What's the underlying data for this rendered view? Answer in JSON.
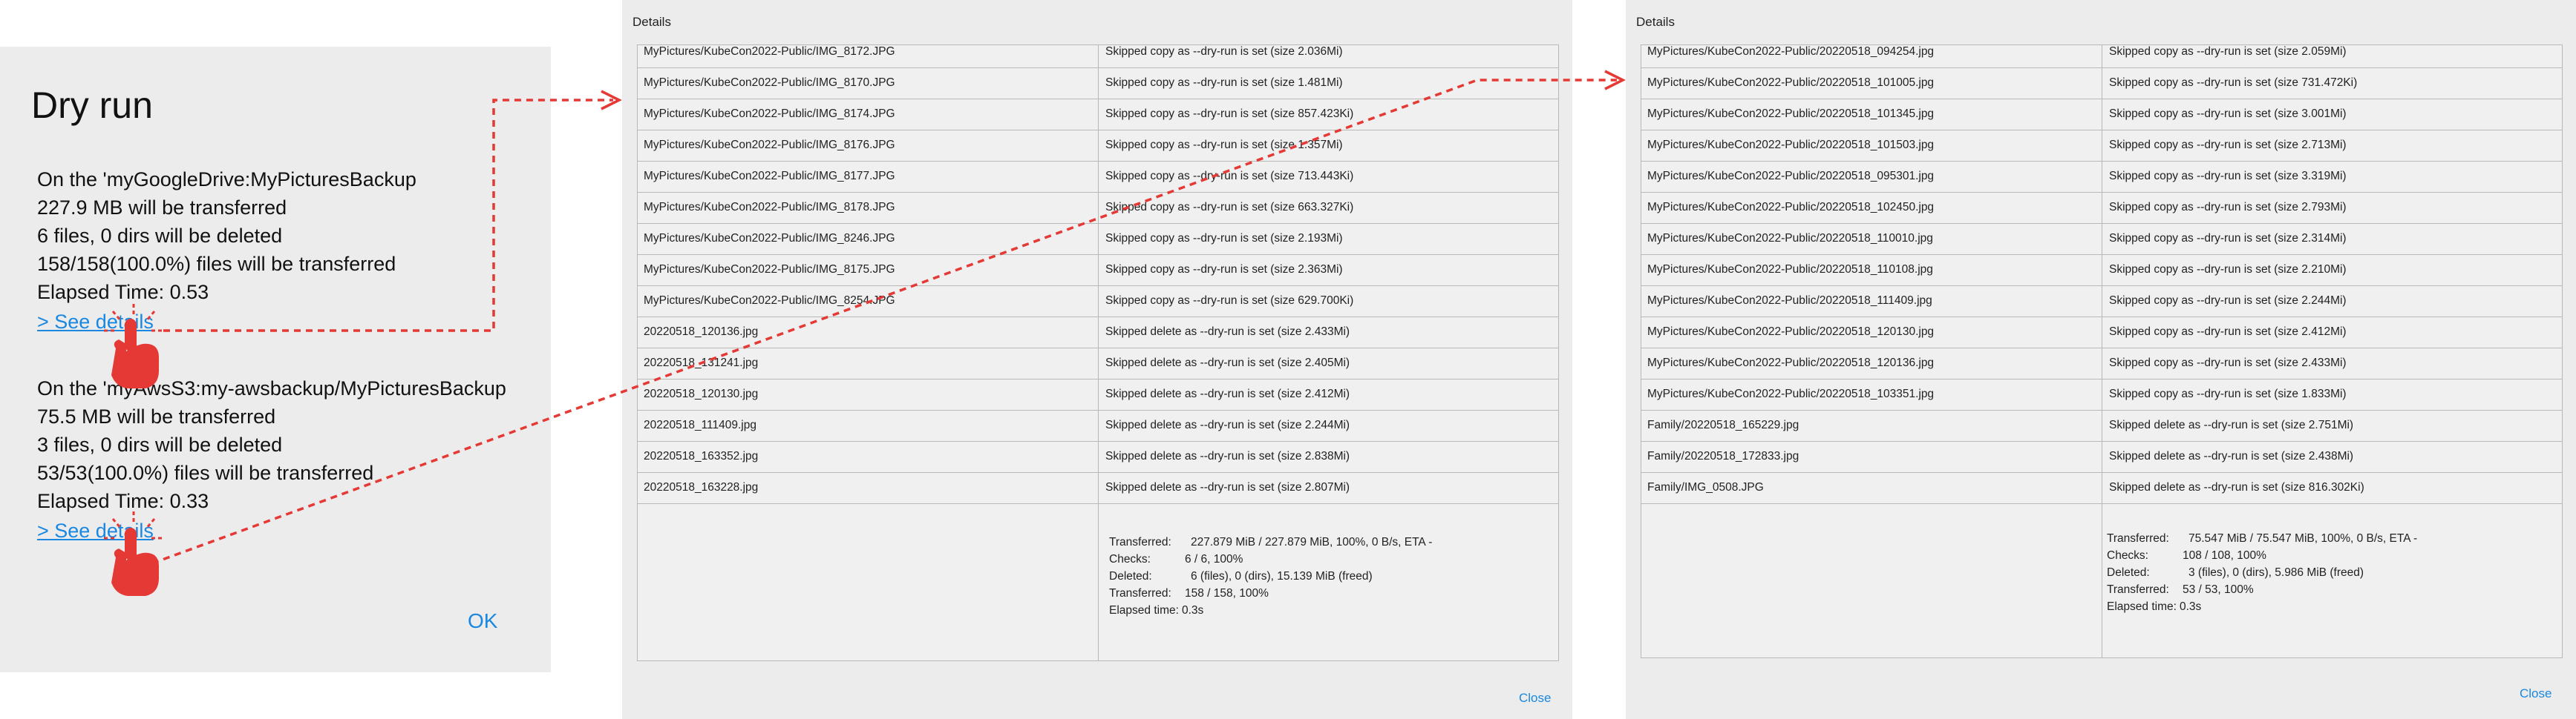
{
  "dry_run": {
    "title": "Dry run",
    "summaries": [
      {
        "remote_line": "On the 'myGoogleDrive:MyPicturesBackup",
        "size_line": "227.9 MB will be transferred",
        "files_line": "6 files, 0 dirs will be deleted",
        "count_line": "158/158(100.0%) files will be transferred",
        "elapsed_line": "Elapsed Time: 0.53",
        "link": "> See details"
      },
      {
        "remote_line": "On the 'myAwsS3:my-awsbackup/MyPicturesBackup",
        "size_line": "75.5 MB will be transferred",
        "files_line": "3 files, 0 dirs will be deleted",
        "count_line": "53/53(100.0%) files will be transferred",
        "elapsed_line": "Elapsed Time: 0.33",
        "link": "> See details"
      }
    ],
    "ok_label": "OK"
  },
  "details_windows": [
    {
      "title": "Details",
      "rows": [
        {
          "file": "MyPictures/KubeCon2022-Public/IMG_8172.JPG",
          "status": "Skipped copy as --dry-run is set (size 2.036Mi)"
        },
        {
          "file": "MyPictures/KubeCon2022-Public/IMG_8170.JPG",
          "status": "Skipped copy as --dry-run is set (size 1.481Mi)"
        },
        {
          "file": "MyPictures/KubeCon2022-Public/IMG_8174.JPG",
          "status": "Skipped copy as --dry-run is set (size 857.423Ki)"
        },
        {
          "file": "MyPictures/KubeCon2022-Public/IMG_8176.JPG",
          "status": "Skipped copy as --dry-run is set (size 1.357Mi)"
        },
        {
          "file": "MyPictures/KubeCon2022-Public/IMG_8177.JPG",
          "status": "Skipped copy as --dry-run is set (size 713.443Ki)"
        },
        {
          "file": "MyPictures/KubeCon2022-Public/IMG_8178.JPG",
          "status": "Skipped copy as --dry-run is set (size 663.327Ki)"
        },
        {
          "file": "MyPictures/KubeCon2022-Public/IMG_8246.JPG",
          "status": "Skipped copy as --dry-run is set (size 2.193Mi)"
        },
        {
          "file": "MyPictures/KubeCon2022-Public/IMG_8175.JPG",
          "status": "Skipped copy as --dry-run is set (size 2.363Mi)"
        },
        {
          "file": "MyPictures/KubeCon2022-Public/IMG_8254.JPG",
          "status": "Skipped copy as --dry-run is set (size 629.700Ki)"
        },
        {
          "file": "20220518_120136.jpg",
          "status": "Skipped delete as --dry-run is set (size 2.433Mi)"
        },
        {
          "file": "20220518_131241.jpg",
          "status": "Skipped delete as --dry-run is set (size 2.405Mi)"
        },
        {
          "file": "20220518_120130.jpg",
          "status": "Skipped delete as --dry-run is set (size 2.412Mi)"
        },
        {
          "file": "20220518_111409.jpg",
          "status": "Skipped delete as --dry-run is set (size 2.244Mi)"
        },
        {
          "file": "20220518_163352.jpg",
          "status": "Skipped delete as --dry-run is set (size 2.838Mi)"
        },
        {
          "file": "20220518_163228.jpg",
          "status": "Skipped delete as --dry-run is set (size 2.807Mi)"
        }
      ],
      "stats": [
        {
          "label": "Transferred:",
          "value": "227.879 MiB / 227.879 MiB, 100%, 0 B/s, ETA -"
        },
        {
          "label": "Checks:",
          "value": "6 / 6, 100%"
        },
        {
          "label": "Deleted:",
          "value": "6 (files), 0 (dirs), 15.139 MiB (freed)"
        },
        {
          "label": "Transferred:",
          "value": "158 / 158, 100%"
        },
        {
          "label": "Elapsed time:",
          "value": "0.3s"
        }
      ],
      "close_label": "Close"
    },
    {
      "title": "Details",
      "rows": [
        {
          "file": "MyPictures/KubeCon2022-Public/20220518_094254.jpg",
          "status": "Skipped copy as --dry-run is set (size 2.059Mi)"
        },
        {
          "file": "MyPictures/KubeCon2022-Public/20220518_101005.jpg",
          "status": "Skipped copy as --dry-run is set (size 731.472Ki)"
        },
        {
          "file": "MyPictures/KubeCon2022-Public/20220518_101345.jpg",
          "status": "Skipped copy as --dry-run is set (size 3.001Mi)"
        },
        {
          "file": "MyPictures/KubeCon2022-Public/20220518_101503.jpg",
          "status": "Skipped copy as --dry-run is set (size 2.713Mi)"
        },
        {
          "file": "MyPictures/KubeCon2022-Public/20220518_095301.jpg",
          "status": "Skipped copy as --dry-run is set (size 3.319Mi)"
        },
        {
          "file": "MyPictures/KubeCon2022-Public/20220518_102450.jpg",
          "status": "Skipped copy as --dry-run is set (size 2.793Mi)"
        },
        {
          "file": "MyPictures/KubeCon2022-Public/20220518_110010.jpg",
          "status": "Skipped copy as --dry-run is set (size 2.314Mi)"
        },
        {
          "file": "MyPictures/KubeCon2022-Public/20220518_110108.jpg",
          "status": "Skipped copy as --dry-run is set (size 2.210Mi)"
        },
        {
          "file": "MyPictures/KubeCon2022-Public/20220518_111409.jpg",
          "status": "Skipped copy as --dry-run is set (size 2.244Mi)"
        },
        {
          "file": "MyPictures/KubeCon2022-Public/20220518_120130.jpg",
          "status": "Skipped copy as --dry-run is set (size 2.412Mi)"
        },
        {
          "file": "MyPictures/KubeCon2022-Public/20220518_120136.jpg",
          "status": "Skipped copy as --dry-run is set (size 2.433Mi)"
        },
        {
          "file": "MyPictures/KubeCon2022-Public/20220518_103351.jpg",
          "status": "Skipped copy as --dry-run is set (size 1.833Mi)"
        },
        {
          "file": "Family/20220518_165229.jpg",
          "status": "Skipped delete as --dry-run is set (size 2.751Mi)"
        },
        {
          "file": "Family/20220518_172833.jpg",
          "status": "Skipped delete as --dry-run is set (size 2.438Mi)"
        },
        {
          "file": "Family/IMG_0508.JPG",
          "status": "Skipped delete as --dry-run is set (size 816.302Ki)"
        }
      ],
      "stats": [
        {
          "label": "Transferred:",
          "value": "75.547 MiB / 75.547 MiB, 100%, 0 B/s, ETA -"
        },
        {
          "label": "Checks:",
          "value": "108 / 108, 100%"
        },
        {
          "label": "Deleted:",
          "value": "3 (files), 0 (dirs), 5.986 MiB (freed)"
        },
        {
          "label": "Transferred:",
          "value": "53 / 53, 100%"
        },
        {
          "label": "Elapsed time:",
          "value": "0.3s"
        }
      ],
      "close_label": "Close"
    }
  ],
  "colors": {
    "link": "#1a88e0",
    "arrow": "#e53935",
    "hand": "#e53935",
    "panel_bg": "#ececec"
  },
  "icons": [
    "pointing-hand-icon",
    "click-burst-icon"
  ]
}
